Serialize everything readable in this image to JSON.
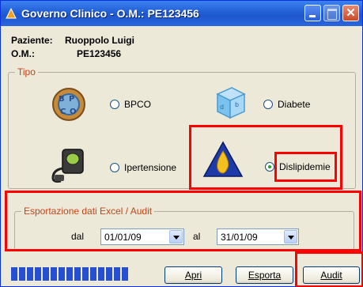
{
  "window": {
    "title": "Governo Clinico - O.M.: PE123456"
  },
  "patient": {
    "label": "Paziente:",
    "name": "Ruoppolo Luigi",
    "om_label": "O.M.:",
    "om_value": "PE123456"
  },
  "tipo": {
    "label": "Tipo",
    "options": [
      {
        "label": "BPCO",
        "checked": false,
        "icon": "bpco-icon"
      },
      {
        "label": "Diabete",
        "checked": false,
        "icon": "diabete-icon"
      },
      {
        "label": "Ipertensione",
        "checked": false,
        "icon": "ipertensione-icon"
      },
      {
        "label": "Dislipidemie",
        "checked": true,
        "icon": "dislipidemie-icon"
      }
    ]
  },
  "export": {
    "label": "Esportazione dati Excel / Audit",
    "from_label": "dal",
    "from_value": "01/01/09",
    "to_label": "al",
    "to_value": "31/01/09"
  },
  "progress": {
    "segments": 15,
    "filled_fraction": 1.0
  },
  "buttons": {
    "apri": "Apri",
    "esporta": "Esporta",
    "audit": "Audit"
  },
  "colors": {
    "highlight": "#ff0000",
    "groupLabel": "#c1451b",
    "progress": "#2650d0"
  }
}
